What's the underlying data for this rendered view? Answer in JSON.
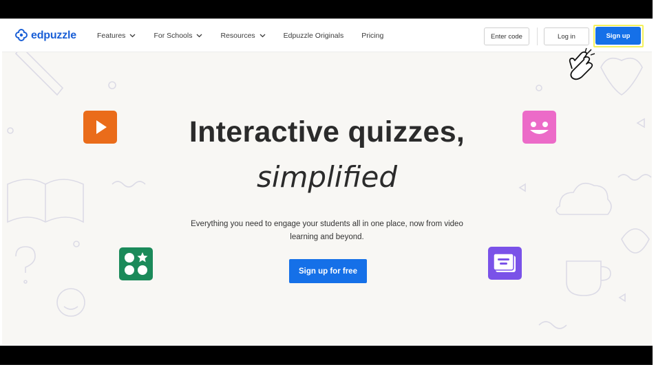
{
  "nav": {
    "brand": "edpuzzle",
    "links": [
      {
        "label": "Features",
        "has_dropdown": true
      },
      {
        "label": "For Schools",
        "has_dropdown": true
      },
      {
        "label": "Resources",
        "has_dropdown": true
      },
      {
        "label": "Edpuzzle Originals",
        "has_dropdown": false
      },
      {
        "label": "Pricing",
        "has_dropdown": false
      }
    ],
    "enter_code_label": "Enter code",
    "login_label": "Log in",
    "signup_label": "Sign up"
  },
  "hero": {
    "title": "Interactive quizzes,",
    "subtitle": "simplified",
    "description_line1": "Everything you need to engage your students all in one place, now from video",
    "description_line2": "learning and beyond.",
    "cta_label": "Sign up for free"
  },
  "icons": {
    "logo": "edpuzzle-logo-icon",
    "play": "play-icon",
    "smile": "smile-face-icon",
    "quiz": "quiz-grid-icon",
    "note": "note-card-icon",
    "cursor": "hand-pointer-cursor-icon"
  },
  "colors": {
    "brand_blue": "#1570e8",
    "logo_blue": "#1a5fd6",
    "highlight_yellow": "#f4f15a",
    "play_tile": "#ea6c1a",
    "smile_tile": "#ec6bc8",
    "quiz_tile": "#1b8a5a",
    "note_tile": "#7a52e8",
    "page_bg": "#f8f7f4"
  }
}
